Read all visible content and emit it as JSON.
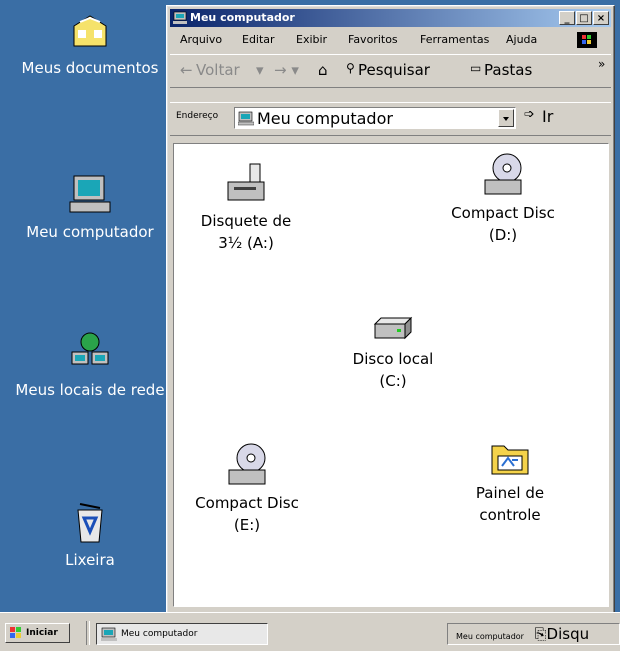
{
  "desktop": {
    "icons": [
      {
        "label": "Meus documentos",
        "icon": "my-documents-folder-icon"
      },
      {
        "label": "Meu computador",
        "icon": "my-computer-icon"
      },
      {
        "label": "Meus locais de rede",
        "icon": "network-places-icon"
      },
      {
        "label": "Lixeira",
        "icon": "recycle-bin-icon"
      }
    ]
  },
  "window": {
    "title": "Meu computador",
    "controls": [
      "_",
      "□",
      "×"
    ],
    "menu": [
      "Arquivo",
      "Editar",
      "Exibir",
      "Favoritos",
      "Ferramentas",
      "Ajuda"
    ],
    "toolbar": {
      "back": "Voltar",
      "search": "Pesquisar",
      "folders": "Pastas",
      "overflow": "»"
    },
    "address": {
      "label": "Endereço",
      "value": "Meu computador",
      "go": "Ir"
    },
    "items": [
      {
        "label_line1": "Disquete de",
        "label_line2": "3½ (A:)",
        "icon": "floppy-drive-icon"
      },
      {
        "label_line1": "Compact Disc",
        "label_line2": "(D:)",
        "icon": "cd-drive-icon"
      },
      {
        "label_line1": "Disco local",
        "label_line2": "(C:)",
        "icon": "hard-disk-icon"
      },
      {
        "label_line1": "Compact Disc",
        "label_line2": "(E:)",
        "icon": "cd-drive-icon"
      },
      {
        "label_line1": "Painel de",
        "label_line2": "controle",
        "icon": "control-panel-folder-icon"
      }
    ]
  },
  "taskbar": {
    "start_label": "Iniciar",
    "task_label": "Meu computador",
    "tray_small": "Meu computador",
    "tray_big": "Disqu"
  }
}
